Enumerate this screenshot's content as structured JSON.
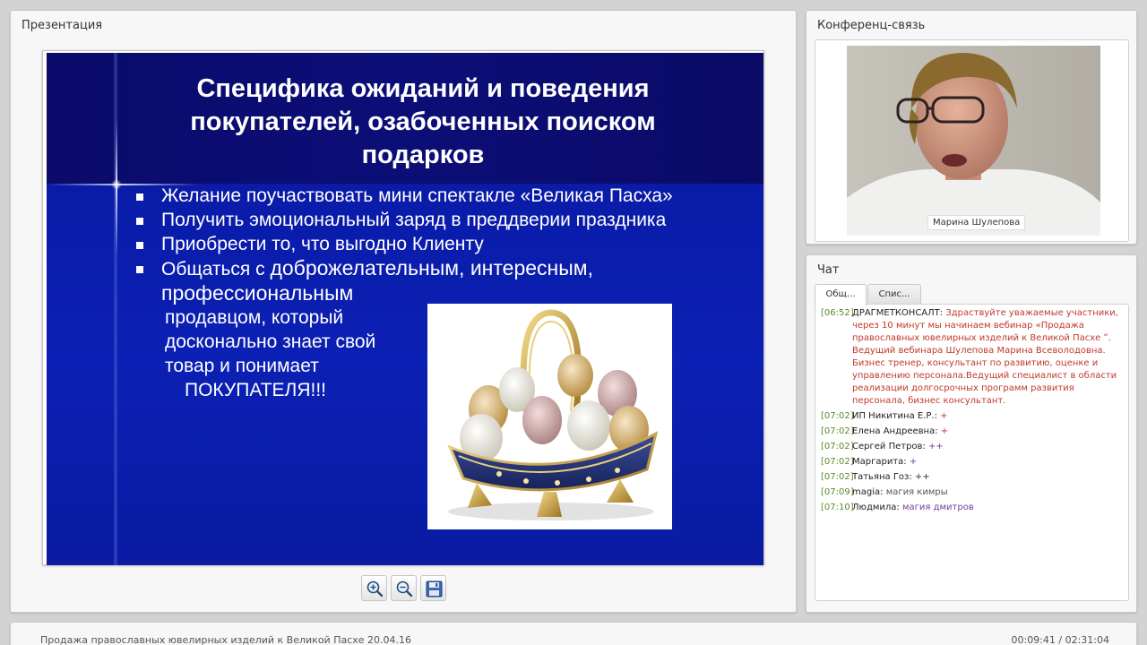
{
  "presentation": {
    "title": "Презентация",
    "slide": {
      "title": "Специфика ожиданий и поведения покупателей, озабоченных поиском подарков",
      "bullets": [
        "Желание поучаствовать мини спектакле «Великая Пасха»",
        "Получить эмоциональный заряд в преддверии праздника",
        "Приобрести то, что выгодно Клиенту"
      ],
      "bullet4_lead": "Общаться с ",
      "bullet4_big": "доброжелательным, интересным,",
      "bullet4_cont": "профессиональным",
      "bullet4_lines": [
        "продавцом, который",
        "досконально знает свой",
        "товар и понимает"
      ],
      "bullet4_last": "ПОКУПАТЕЛЯ!!!"
    },
    "toolbar": {
      "zoom_in_icon": "zoom-in-icon",
      "zoom_out_icon": "zoom-out-icon",
      "save_icon": "floppy-disk-icon"
    }
  },
  "conference": {
    "title": "Конференц-связь",
    "speaker_name": "Марина Шулепова"
  },
  "chat": {
    "title": "Чат",
    "tabs": [
      "Общ...",
      "Спис..."
    ],
    "messages": [
      {
        "time": "[06:52]",
        "user": "ДРАГМЕТКОНСАЛТ:",
        "text": "Здраствуйте уважаемые участники, через 10 минут мы начинаем вебинар «Продажа православных ювелирных изделий к Великой Пасхе ˮ. Ведущий вебинара Шулепова Марина Всеволодовна. Бизнес тренер, консультант по развитию, оценке и управлению персонала.Ведущий специалист в области реализации долгосрочных программ развития персонала, бизнес консультант.",
        "color": "#c0392b"
      },
      {
        "time": "[07:02]",
        "user": "ИП Никитина Е.Р.:",
        "text": "+",
        "color": "#c0392b"
      },
      {
        "time": "[07:02]",
        "user": "Елена Андреевна:",
        "text": "+",
        "color": "#c0392b"
      },
      {
        "time": "[07:02]",
        "user": "Сергей Петров:",
        "text": "++",
        "color": "#7a3a9a"
      },
      {
        "time": "[07:02]",
        "user": "Маргарита:",
        "text": "+",
        "color": "#7a3a9a"
      },
      {
        "time": "[07:02]",
        "user": "Татьяна Гоз:",
        "text": "++",
        "color": "#333333"
      },
      {
        "time": "[07:09]",
        "user": "magia:",
        "text": "магия кимры",
        "color": "#555555"
      },
      {
        "time": "[07:10]",
        "user": "Людмила:",
        "text": "магия дмитров",
        "color": "#7a3a9a"
      }
    ]
  },
  "footer": {
    "title": "Продажа православных ювелирных изделий к Великой Пасхе 20.04.16",
    "time": "00:09:41 / 02:31:04"
  }
}
